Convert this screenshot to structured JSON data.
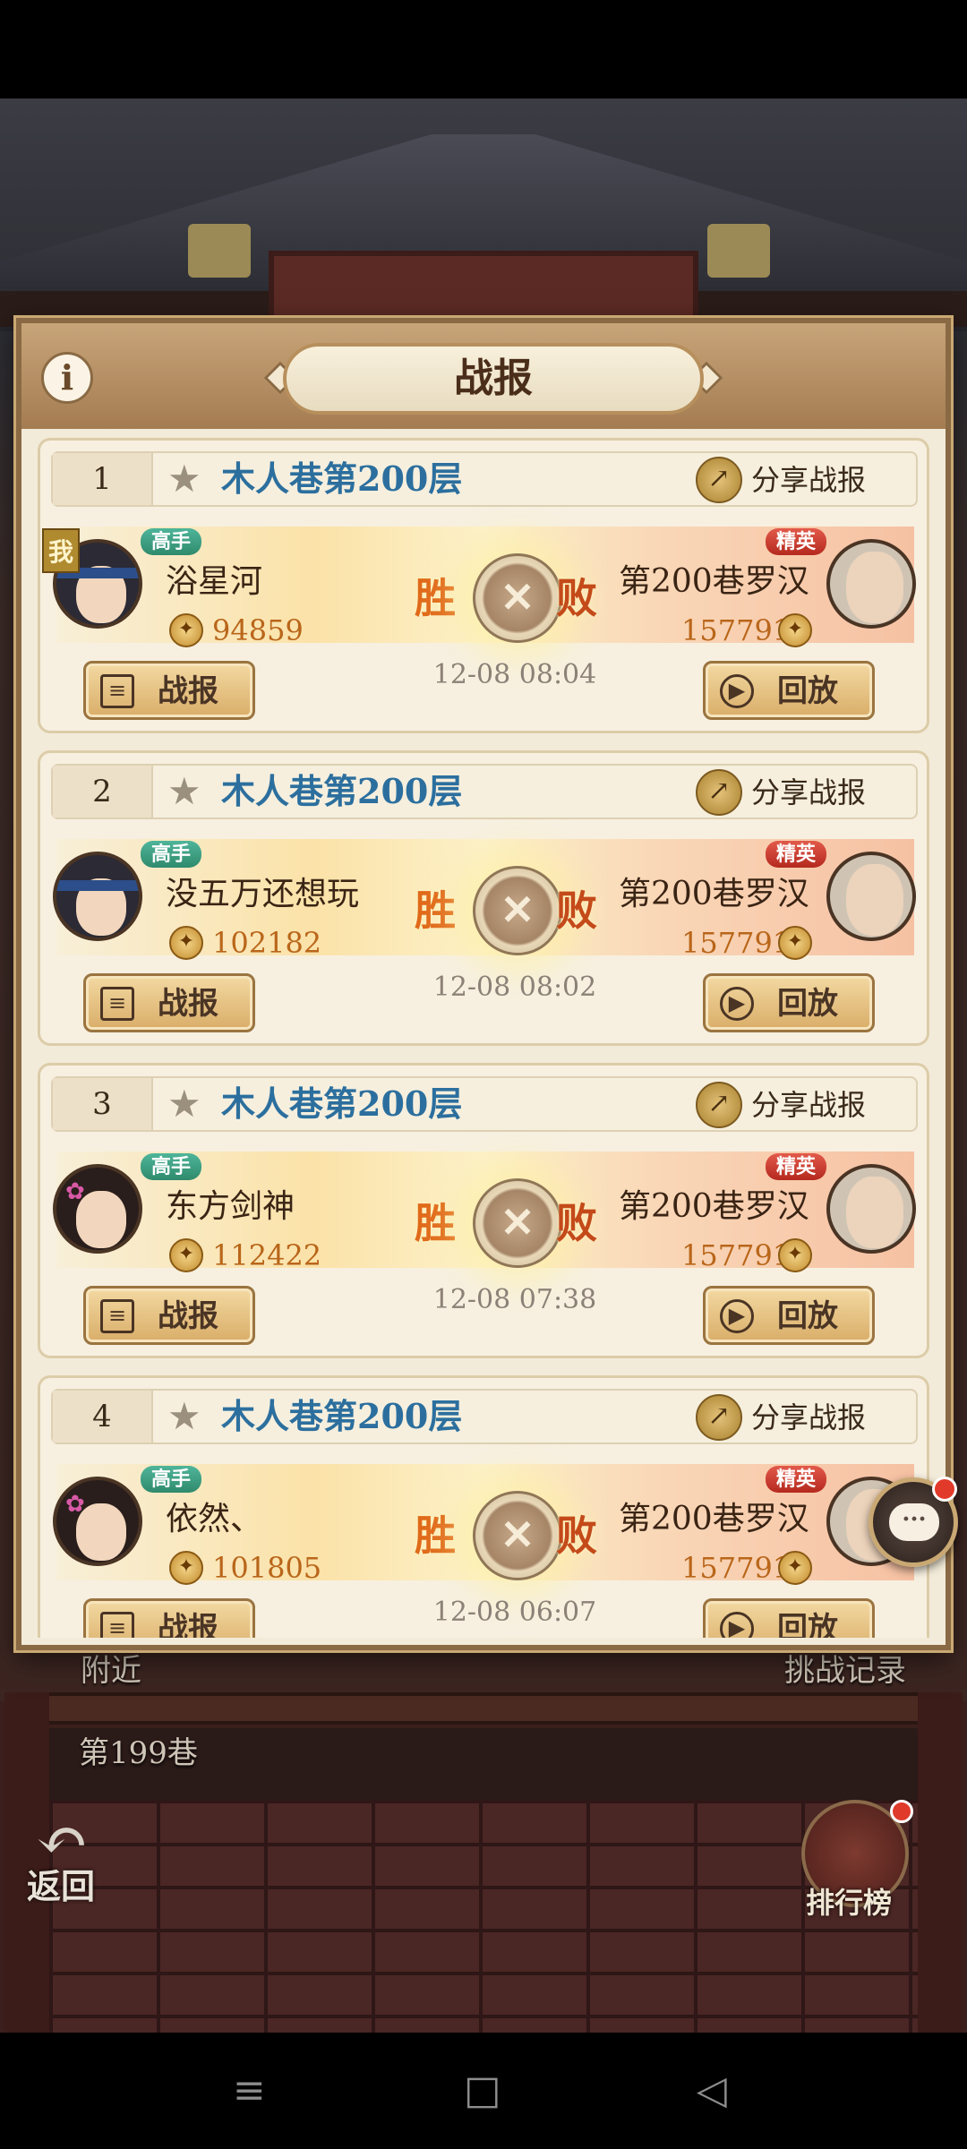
{
  "modal": {
    "title": "战报",
    "info_label": "i"
  },
  "battles": [
    {
      "index": "1",
      "floor": "木人巷第200层",
      "share_label": "分享战报",
      "me_badge": "我",
      "player": {
        "tag": "高手",
        "name": "浴星河",
        "power": "94859"
      },
      "result_win": "胜",
      "result_lose": "败",
      "opponent": {
        "tag": "精英",
        "name": "第200巷罗汉",
        "power": "157791"
      },
      "time": "12-08 08:04",
      "report_label": "战报",
      "replay_label": "回放"
    },
    {
      "index": "2",
      "floor": "木人巷第200层",
      "share_label": "分享战报",
      "player": {
        "tag": "高手",
        "name": "没五万还想玩",
        "power": "102182"
      },
      "result_win": "胜",
      "result_lose": "败",
      "opponent": {
        "tag": "精英",
        "name": "第200巷罗汉",
        "power": "157791"
      },
      "time": "12-08 08:02",
      "report_label": "战报",
      "replay_label": "回放"
    },
    {
      "index": "3",
      "floor": "木人巷第200层",
      "share_label": "分享战报",
      "player": {
        "tag": "高手",
        "name": "东方剑神",
        "power": "112422"
      },
      "result_win": "胜",
      "result_lose": "败",
      "opponent": {
        "tag": "精英",
        "name": "第200巷罗汉",
        "power": "157791"
      },
      "time": "12-08 07:38",
      "report_label": "战报",
      "replay_label": "回放"
    },
    {
      "index": "4",
      "floor": "木人巷第200层",
      "share_label": "分享战报",
      "player": {
        "tag": "高手",
        "name": "依然、",
        "power": "101805"
      },
      "result_win": "胜",
      "result_lose": "败",
      "opponent": {
        "tag": "精英",
        "name": "第200巷罗汉",
        "power": "157791"
      },
      "time": "12-08 06:07",
      "report_label": "战报",
      "replay_label": "回放"
    }
  ],
  "background": {
    "nearby_label": "附近",
    "challenge_log_label": "挑战记录",
    "lane_label": "第199巷",
    "back_label": "返回",
    "ranking_label": "排行榜"
  },
  "colors": {
    "floor_text": "#2c6f9e",
    "tag_green": "#2f8a6c",
    "tag_red": "#b5291e",
    "power_text": "#b9661a",
    "win_text": "#e06a1a"
  },
  "icons": {
    "info": "info-icon",
    "star": "star-icon",
    "share": "share-icon",
    "coin": "coin-icon",
    "vs": "crossed-swords-icon",
    "report": "list-icon",
    "replay": "play-icon",
    "chat": "chat-icon",
    "back": "back-arrow-icon",
    "ranking": "ranking-icon"
  }
}
